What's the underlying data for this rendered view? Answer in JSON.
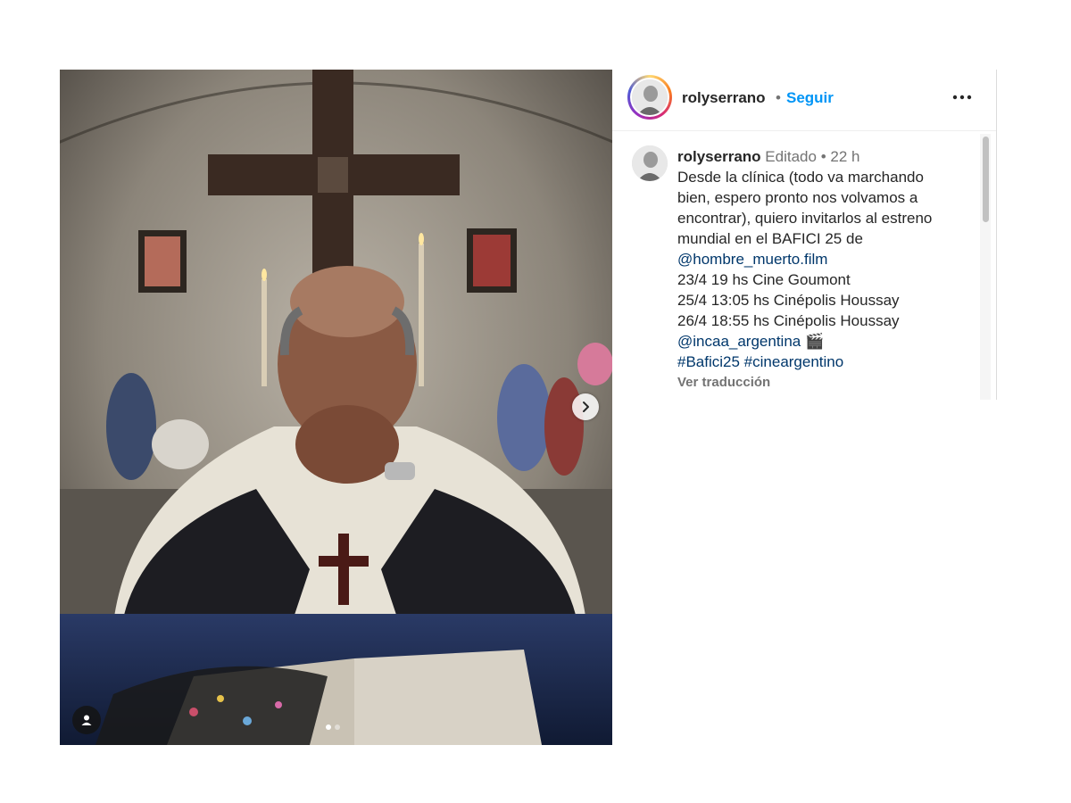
{
  "post": {
    "media": {
      "image_description": "photo",
      "carousel_dots": 2,
      "active_dot": 0
    },
    "header": {
      "username": "rolyserrano",
      "separator": "•",
      "follow_label": "Seguir"
    },
    "caption": {
      "username": "rolyserrano",
      "edited_label": "Editado",
      "dot": "•",
      "time": "22 h",
      "lines": [
        "Desde la clínica (todo va marchando",
        "bien, espero pronto nos volvamos a",
        "encontrar), quiero invitarlos al estreno",
        "mundial en el BAFICI 25 de"
      ],
      "mention_film": "@hombre_muerto.film",
      "screenings": [
        "23/4 19 hs Cine Goumont",
        "25/4 13:05 hs Cinépolis Houssay",
        "26/4 18:55 hs Cinépolis Houssay"
      ],
      "mention_incaa": "@incaa_argentina",
      "emoji": "🎬",
      "hashtag1": "#Bafici25",
      "hashtag2": "#cineargentino",
      "translate_label": "Ver traducción"
    }
  },
  "icons": {
    "next": "chevron-right-icon",
    "more": "more-horizontal-icon",
    "tag": "user-tag-icon"
  }
}
